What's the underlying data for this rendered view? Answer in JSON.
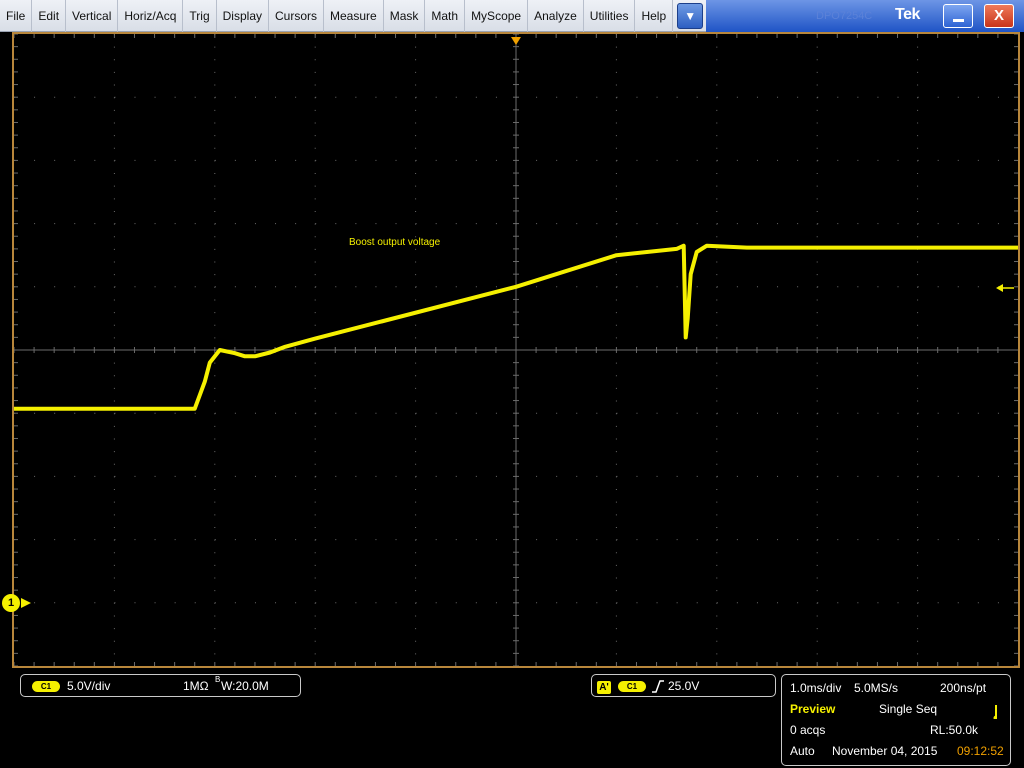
{
  "menu": {
    "items": [
      "File",
      "Edit",
      "Vertical",
      "Horiz/Acq",
      "Trig",
      "Display",
      "Cursors",
      "Measure",
      "Mask",
      "Math",
      "MyScope",
      "Analyze",
      "Utilities",
      "Help"
    ],
    "dropdown_icon": "chevron-down-icon",
    "title_ghost": "DPO7254C",
    "logo": "Tek",
    "minimize_icon": "minimize-icon",
    "close_label": "X"
  },
  "display": {
    "annotation": "Boost output voltage",
    "channel_marker": "1",
    "colors": {
      "trace": "#f5f000",
      "grid": "#6b6b6b",
      "frame": "#b8863b",
      "background": "#000000"
    }
  },
  "chart_data": {
    "type": "line",
    "xlim": [
      -5,
      5
    ],
    "ylim": [
      -5,
      5
    ],
    "xlabel": "",
    "ylabel": "",
    "grid": true,
    "grid_divisions": {
      "x": 10,
      "y": 10
    },
    "series": [
      {
        "x": [
          -5.0,
          -3.2,
          -3.1,
          -3.05,
          -2.95,
          -2.8,
          -2.7,
          -2.6,
          -2.45,
          -2.3,
          -2.0,
          0.0,
          1.0,
          1.6,
          1.67,
          1.69,
          1.71,
          1.74,
          1.8,
          1.9,
          2.3,
          3.0,
          4.0,
          5.0
        ],
        "y": [
          -0.93,
          -0.93,
          -0.5,
          -0.2,
          0.0,
          -0.05,
          -0.1,
          -0.1,
          -0.04,
          0.05,
          0.18,
          1.0,
          1.5,
          1.6,
          1.65,
          0.2,
          0.5,
          1.2,
          1.55,
          1.65,
          1.62,
          1.62,
          1.62,
          1.62
        ]
      }
    ]
  },
  "channel_info": {
    "badge": "C1",
    "scale": "5.0V/div",
    "impedance": "1MΩ",
    "bandwidth_b": "B",
    "bandwidth": "W:20.0M"
  },
  "trigger_info": {
    "source_badge": "A'",
    "channel_badge": "C1",
    "slope_icon": "rising-edge-icon",
    "level": "25.0V"
  },
  "acquisition": {
    "timebase": "1.0ms/div",
    "sample_rate": "5.0MS/s",
    "resolution": "200ns/pt",
    "mode_label": "Preview",
    "run_mode": "Single Seq",
    "acqs": "0 acqs",
    "record_length": "RL:50.0k",
    "trigger_mode": "Auto",
    "date": "November 04, 2015",
    "time": "09:12:52",
    "colors": {
      "preview": "#f5f000",
      "time": "#f0a000"
    }
  }
}
